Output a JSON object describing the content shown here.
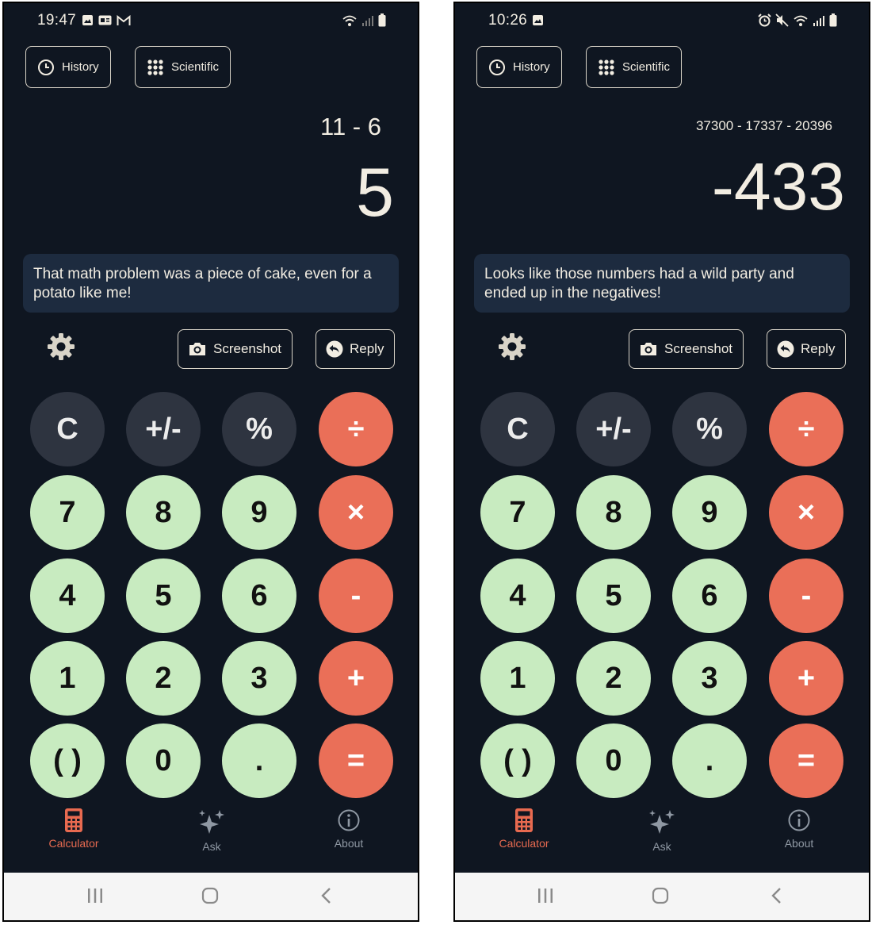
{
  "screens": [
    {
      "status_time": "19:47",
      "expression": "11 - 6",
      "result": "5",
      "message": "That math problem was a piece of cake, even for a potato like me!"
    },
    {
      "status_time": "10:26",
      "expression": "37300 - 17337 - 20396",
      "result": "-433",
      "message": "Looks like those numbers had a wild party and ended up in the negatives!"
    }
  ],
  "toolbar": {
    "history_label": "History",
    "scientific_label": "Scientific"
  },
  "actions": {
    "screenshot_label": "Screenshot",
    "reply_label": "Reply"
  },
  "keypad": {
    "rows": [
      [
        "C",
        "+/-",
        "%",
        "÷"
      ],
      [
        "7",
        "8",
        "9",
        "×"
      ],
      [
        "4",
        "5",
        "6",
        "-"
      ],
      [
        "1",
        "2",
        "3",
        "+"
      ],
      [
        "( )",
        "0",
        ".",
        "="
      ]
    ]
  },
  "nav": {
    "calculator_label": "Calculator",
    "ask_label": "Ask",
    "about_label": "About"
  },
  "colors": {
    "background": "#0f1621",
    "banner": "#1d2b3f",
    "function_key": "#2e3440",
    "number_key": "#c8ebc0",
    "operator_key": "#ea6f58",
    "active_nav": "#e86a50"
  }
}
